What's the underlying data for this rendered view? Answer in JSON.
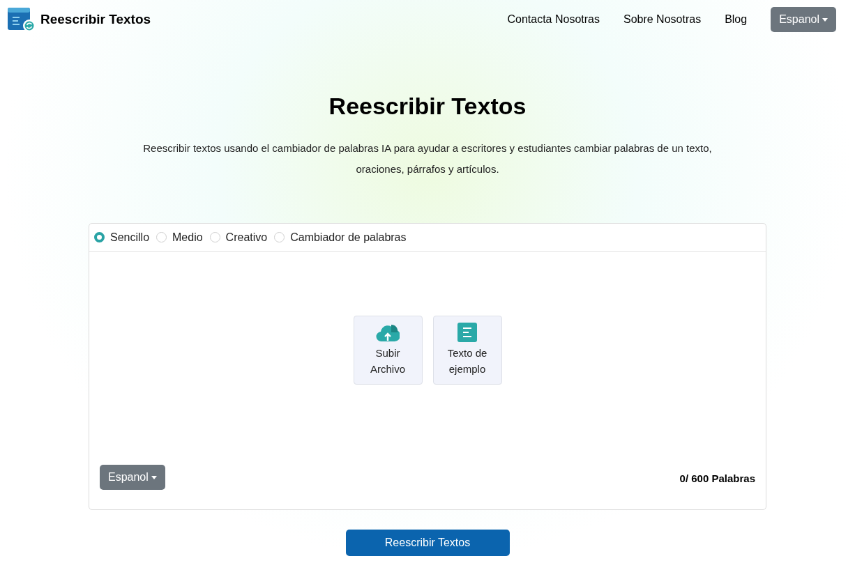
{
  "header": {
    "brand": "Reescribir Textos",
    "nav": [
      "Contacta Nosotras",
      "Sobre Nosotras",
      "Blog"
    ],
    "language_button": "Espanol"
  },
  "hero": {
    "title": "Reescribir Textos",
    "description": "Reescribir textos usando el cambiador de palabras IA para ayudar a escritores y estudiantes cambiar palabras de un texto, oraciones, párrafos y artículos."
  },
  "modes": [
    {
      "label": "Sencillo",
      "selected": true
    },
    {
      "label": "Medio",
      "selected": false
    },
    {
      "label": "Creativo",
      "selected": false
    },
    {
      "label": "Cambiador de palabras",
      "selected": false
    }
  ],
  "actions": [
    {
      "kind": "upload",
      "label": "Subir Archivo"
    },
    {
      "kind": "sample",
      "label": "Texto de ejemplo"
    }
  ],
  "editor": {
    "language_button": "Espanol",
    "word_count": "0/ 600 Palabras"
  },
  "submit_button": "Reescribir Textos"
}
